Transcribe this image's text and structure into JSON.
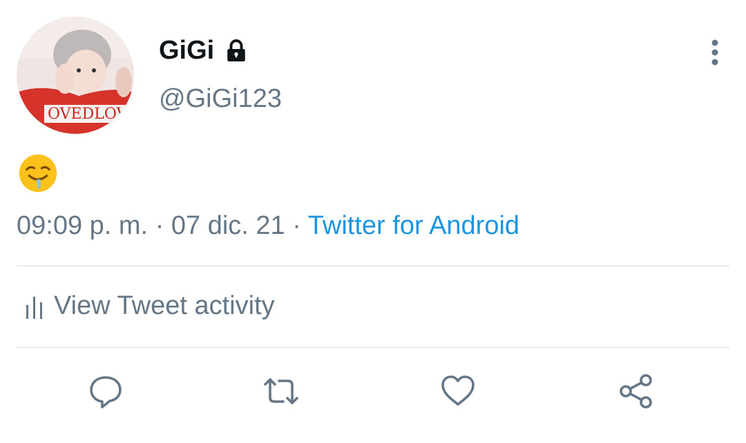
{
  "tweet": {
    "author": {
      "name": "GiGi",
      "handle": "@GiGi123",
      "protected": true
    },
    "content_emoji": "drooling-smile",
    "time": "09:09 p. m.",
    "date": "07 dic. 21",
    "separator": "·",
    "source": "Twitter for Android"
  },
  "activity": {
    "label": "View Tweet activity"
  },
  "actions": [
    "reply",
    "retweet",
    "like",
    "share"
  ],
  "colors": {
    "accent": "#1b95e0",
    "secondary_text": "#657786",
    "divider": "#d6dbe0",
    "icon": "#657786"
  },
  "icons": {
    "lock": "lock-icon",
    "more": "more-vertical-icon",
    "activity": "bar-chart-icon"
  }
}
